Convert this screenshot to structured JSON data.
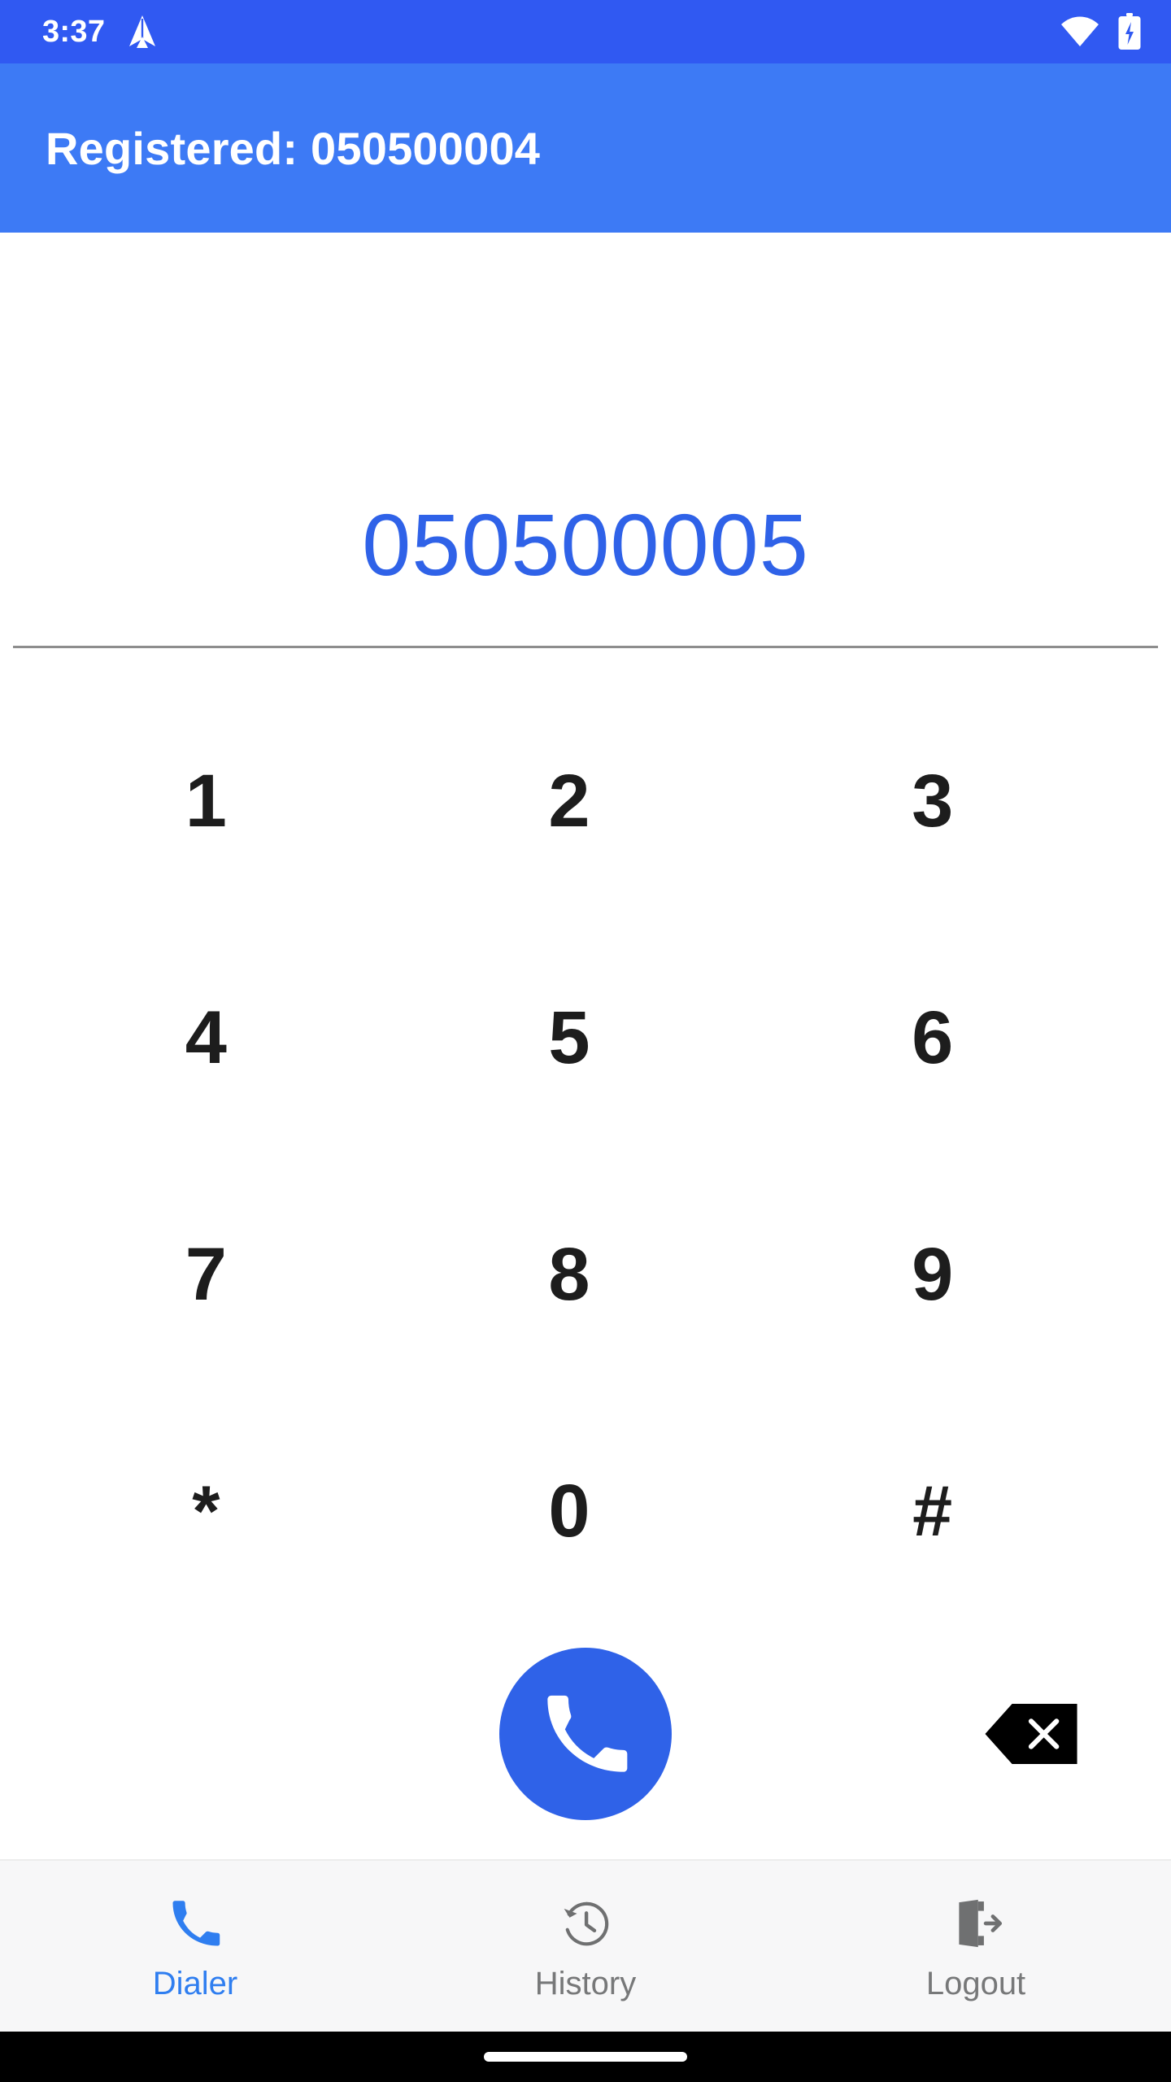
{
  "status_bar": {
    "time": "3:37",
    "icons": [
      "navigation-arrow-icon",
      "wifi-icon",
      "battery-charging-icon"
    ],
    "background_color": "#3059f2"
  },
  "app_bar": {
    "title": "Registered: 050500004",
    "background_color": "#3d7af5",
    "text_color": "#ffffff"
  },
  "dialer": {
    "entered_number": "050500005",
    "number_color": "#2f62e8",
    "divider_color": "#8d8d8d",
    "keys": [
      {
        "label": "1",
        "name": "key-1"
      },
      {
        "label": "2",
        "name": "key-2"
      },
      {
        "label": "3",
        "name": "key-3"
      },
      {
        "label": "4",
        "name": "key-4"
      },
      {
        "label": "5",
        "name": "key-5"
      },
      {
        "label": "6",
        "name": "key-6"
      },
      {
        "label": "7",
        "name": "key-7"
      },
      {
        "label": "8",
        "name": "key-8"
      },
      {
        "label": "9",
        "name": "key-9"
      },
      {
        "label": "*",
        "name": "key-star"
      },
      {
        "label": "0",
        "name": "key-0"
      },
      {
        "label": "#",
        "name": "key-hash"
      }
    ],
    "call_button": {
      "icon": "phone-icon",
      "color": "#2f62e8"
    },
    "backspace_button": {
      "icon": "backspace-icon",
      "color": "#000000"
    }
  },
  "bottom_nav": {
    "items": [
      {
        "label": "Dialer",
        "icon": "phone-icon",
        "active": true
      },
      {
        "label": "History",
        "icon": "history-clock-icon",
        "active": false
      },
      {
        "label": "Logout",
        "icon": "logout-door-icon",
        "active": false
      }
    ],
    "active_color": "#2f7ef0",
    "inactive_color": "#777879"
  }
}
